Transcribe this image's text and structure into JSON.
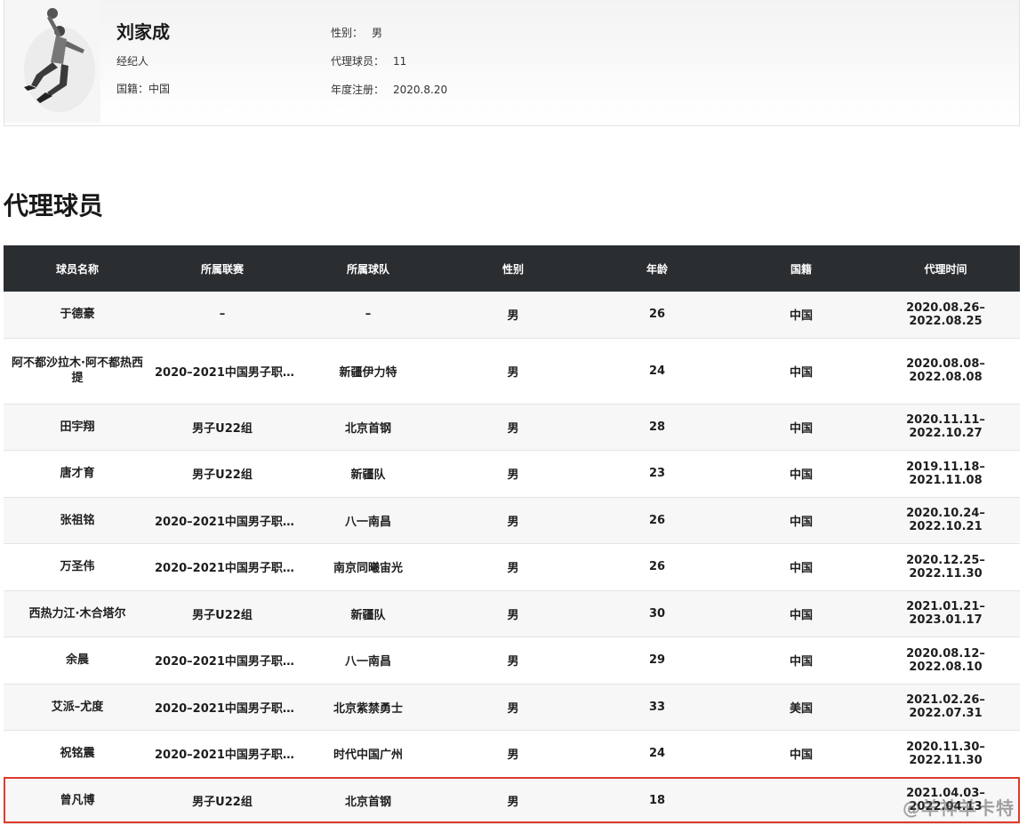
{
  "profile": {
    "name": "刘家成",
    "role": "经纪人",
    "nationality_label": "国籍：",
    "nationality_value": "中国",
    "gender_label": "性别：",
    "gender_value": "男",
    "players_label": "代理球员：",
    "players_value": "11",
    "registration_label": "年度注册：",
    "registration_value": "2020.8.20"
  },
  "section_title": "代理球员",
  "table": {
    "headers": [
      "球员名称",
      "所属联赛",
      "所属球队",
      "性别",
      "年龄",
      "国籍",
      "代理时间"
    ],
    "rows": [
      [
        "于德豪",
        "–",
        "–",
        "男",
        "26",
        "中国",
        "2020.08.26–2022.08.25"
      ],
      [
        "阿不都沙拉木·阿不都热西提",
        "2020–2021中国男子职…",
        "新疆伊力特",
        "男",
        "24",
        "中国",
        "2020.08.08–2022.08.08"
      ],
      [
        "田宇翔",
        "男子U22组",
        "北京首钢",
        "男",
        "28",
        "中国",
        "2020.11.11–2022.10.27"
      ],
      [
        "唐才育",
        "男子U22组",
        "新疆队",
        "男",
        "23",
        "中国",
        "2019.11.18–2021.11.08"
      ],
      [
        "张祖铭",
        "2020–2021中国男子职…",
        "八一南昌",
        "男",
        "26",
        "中国",
        "2020.10.24–2022.10.21"
      ],
      [
        "万圣伟",
        "2020–2021中国男子职…",
        "南京同曦宙光",
        "男",
        "26",
        "中国",
        "2020.12.25–2022.11.30"
      ],
      [
        "西热力江·木合塔尔",
        "男子U22组",
        "新疆队",
        "男",
        "30",
        "中国",
        "2021.01.21–2023.01.17"
      ],
      [
        "余晨",
        "2020–2021中国男子职…",
        "八一南昌",
        "男",
        "29",
        "中国",
        "2020.08.12–2022.08.10"
      ],
      [
        "艾派–尤度",
        "2020–2021中国男子职…",
        "北京紫禁勇士",
        "男",
        "33",
        "美国",
        "2021.02.26–2022.07.31"
      ],
      [
        "祝铭震",
        "2020–2021中国男子职…",
        "时代中国广州",
        "男",
        "24",
        "中国",
        "2020.11.30–2022.11.30"
      ],
      [
        "曾凡博",
        "男子U22组",
        "北京首钢",
        "男",
        "18",
        "",
        "2021.04.03–2022.04.13"
      ]
    ],
    "highlight_row": 10
  },
  "watermark": "@羊神羊卡特"
}
